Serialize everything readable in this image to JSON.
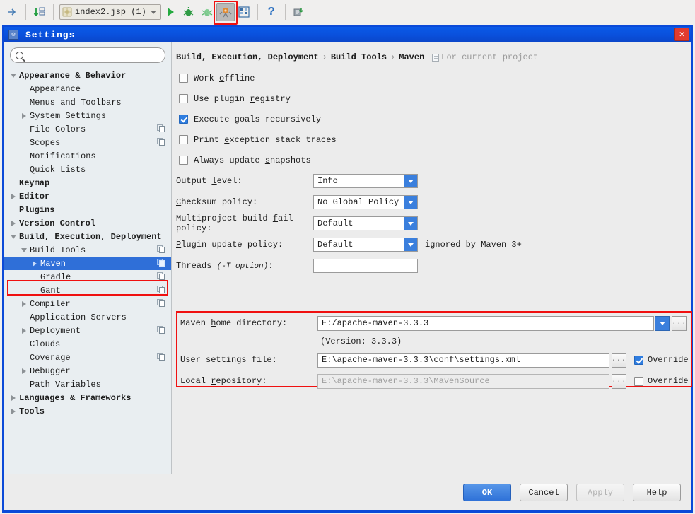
{
  "ide_toolbar": {
    "nav_forward_icon": "arrow-right-icon",
    "sort_icon": "sort-numeric-icon",
    "run_config": {
      "icon": "jsp-file-icon",
      "label": "index2.jsp (1)",
      "caret_icon": "chevron-down-icon"
    },
    "run_icon": "run-play-icon",
    "debug_icon": "debug-bug-icon",
    "coverage_icon": "run-coverage-icon",
    "settings_icon": "settings-wrench-icon",
    "project_structure_icon": "project-structure-icon",
    "help_icon": "help-question-icon",
    "update_icon": "update-project-icon"
  },
  "window": {
    "title": "Settings",
    "title_icon": "settings-window-icon",
    "close_label": "✕",
    "close_icon": "close-icon"
  },
  "sidebar": {
    "search": {
      "value": "",
      "placeholder": "",
      "icon": "search-icon"
    },
    "tree": [
      {
        "label": "Appearance & Behavior",
        "indent": 0,
        "arrow": "expanded",
        "bold": true,
        "copy": false
      },
      {
        "label": "Appearance",
        "indent": 1,
        "arrow": "none",
        "bold": false,
        "copy": false
      },
      {
        "label": "Menus and Toolbars",
        "indent": 1,
        "arrow": "none",
        "bold": false,
        "copy": false
      },
      {
        "label": "System Settings",
        "indent": 1,
        "arrow": "collapsed",
        "bold": false,
        "copy": false
      },
      {
        "label": "File Colors",
        "indent": 1,
        "arrow": "none",
        "bold": false,
        "copy": true
      },
      {
        "label": "Scopes",
        "indent": 1,
        "arrow": "none",
        "bold": false,
        "copy": true
      },
      {
        "label": "Notifications",
        "indent": 1,
        "arrow": "none",
        "bold": false,
        "copy": false
      },
      {
        "label": "Quick Lists",
        "indent": 1,
        "arrow": "none",
        "bold": false,
        "copy": false
      },
      {
        "label": "Keymap",
        "indent": 0,
        "arrow": "none",
        "bold": true,
        "copy": false
      },
      {
        "label": "Editor",
        "indent": 0,
        "arrow": "collapsed",
        "bold": true,
        "copy": false
      },
      {
        "label": "Plugins",
        "indent": 0,
        "arrow": "none",
        "bold": true,
        "copy": false
      },
      {
        "label": "Version Control",
        "indent": 0,
        "arrow": "collapsed",
        "bold": true,
        "copy": false
      },
      {
        "label": "Build, Execution, Deployment",
        "indent": 0,
        "arrow": "expanded",
        "bold": true,
        "copy": false
      },
      {
        "label": "Build Tools",
        "indent": 1,
        "arrow": "expanded",
        "bold": false,
        "copy": true
      },
      {
        "label": "Maven",
        "indent": 2,
        "arrow": "collapsed",
        "bold": false,
        "copy": true,
        "selected": true
      },
      {
        "label": "Gradle",
        "indent": 2,
        "arrow": "none",
        "bold": false,
        "copy": true
      },
      {
        "label": "Gant",
        "indent": 2,
        "arrow": "none",
        "bold": false,
        "copy": true
      },
      {
        "label": "Compiler",
        "indent": 1,
        "arrow": "collapsed",
        "bold": false,
        "copy": true
      },
      {
        "label": "Application Servers",
        "indent": 1,
        "arrow": "none",
        "bold": false,
        "copy": false
      },
      {
        "label": "Deployment",
        "indent": 1,
        "arrow": "collapsed",
        "bold": false,
        "copy": true
      },
      {
        "label": "Clouds",
        "indent": 1,
        "arrow": "none",
        "bold": false,
        "copy": false
      },
      {
        "label": "Coverage",
        "indent": 1,
        "arrow": "none",
        "bold": false,
        "copy": true
      },
      {
        "label": "Debugger",
        "indent": 1,
        "arrow": "collapsed",
        "bold": false,
        "copy": false
      },
      {
        "label": "Path Variables",
        "indent": 1,
        "arrow": "none",
        "bold": false,
        "copy": false
      },
      {
        "label": "Languages & Frameworks",
        "indent": 0,
        "arrow": "collapsed",
        "bold": true,
        "copy": false
      },
      {
        "label": "Tools",
        "indent": 0,
        "arrow": "collapsed",
        "bold": true,
        "copy": false
      }
    ]
  },
  "breadcrumb": {
    "part1": "Build, Execution, Deployment",
    "sep1": "›",
    "part2": "Build Tools",
    "sep2": "›",
    "part3": "Maven",
    "project_scope": "For current project",
    "project_icon": "project-scope-icon"
  },
  "checkboxes": [
    {
      "label": "Work offline",
      "checked": false,
      "mnemonic": "o",
      "pre": "Work ",
      "post": "ffline"
    },
    {
      "label": "Use plugin registry",
      "checked": false,
      "mnemonic": "r",
      "pre": "Use plugin ",
      "post": "egistry"
    },
    {
      "label": "Execute goals recursively",
      "checked": true,
      "mnemonic": "g",
      "pre": "Execute ",
      "post": "oals recursively"
    },
    {
      "label": "Print exception stack traces",
      "checked": false,
      "mnemonic": "e",
      "pre": "Print ",
      "post": "xception stack traces"
    },
    {
      "label": "Always update snapshots",
      "checked": false,
      "mnemonic": "s",
      "pre": "Always update ",
      "post": "napshots"
    }
  ],
  "fields": {
    "output_level": {
      "pre": "Output ",
      "mn": "l",
      "post": "evel:",
      "value": "Info"
    },
    "checksum_policy": {
      "pre": "",
      "mn": "C",
      "post": "hecksum policy:",
      "value": "No Global Policy"
    },
    "multiproject": {
      "pre": "Multiproject build ",
      "mn": "f",
      "post": "ail policy:",
      "value": "Default"
    },
    "plugin_update": {
      "pre": "",
      "mn": "P",
      "post": "lugin update policy:",
      "value": "Default",
      "hint": "ignored by Maven 3+"
    },
    "threads": {
      "pre": "Threads ",
      "opt": "(-T option)",
      "post": ":",
      "value": ""
    }
  },
  "maven": {
    "home_dir": {
      "pre": "Maven ",
      "mn": "h",
      "post": "ome directory:",
      "value": "E:/apache-maven-3.3.3",
      "caret_icon": "chevron-down-icon",
      "browse_icon": "ellipsis-browse-icon",
      "browse_label": "..."
    },
    "version_line": "(Version: 3.3.3)",
    "user_settings": {
      "pre": "User ",
      "mn": "s",
      "post": "ettings file:",
      "value": "E:\\apache-maven-3.3.3\\conf\\settings.xml",
      "browse_label": "...",
      "override_label": "Override",
      "override_checked": true
    },
    "local_repo": {
      "pre": "Local ",
      "mn": "r",
      "post": "epository:",
      "value": "E:\\apache-maven-3.3.3\\MavenSource",
      "browse_label": "...",
      "override_label": "Override",
      "override_checked": false,
      "disabled": true
    }
  },
  "footer": {
    "ok": "OK",
    "cancel": "Cancel",
    "apply": "Apply",
    "help": "Help"
  },
  "colors": {
    "accent_blue": "#2f6fd8",
    "title_blue": "#0a50dc",
    "highlight_red": "#f01010",
    "sidebar_bg": "#e9eef1",
    "panel_bg": "#ececec"
  }
}
